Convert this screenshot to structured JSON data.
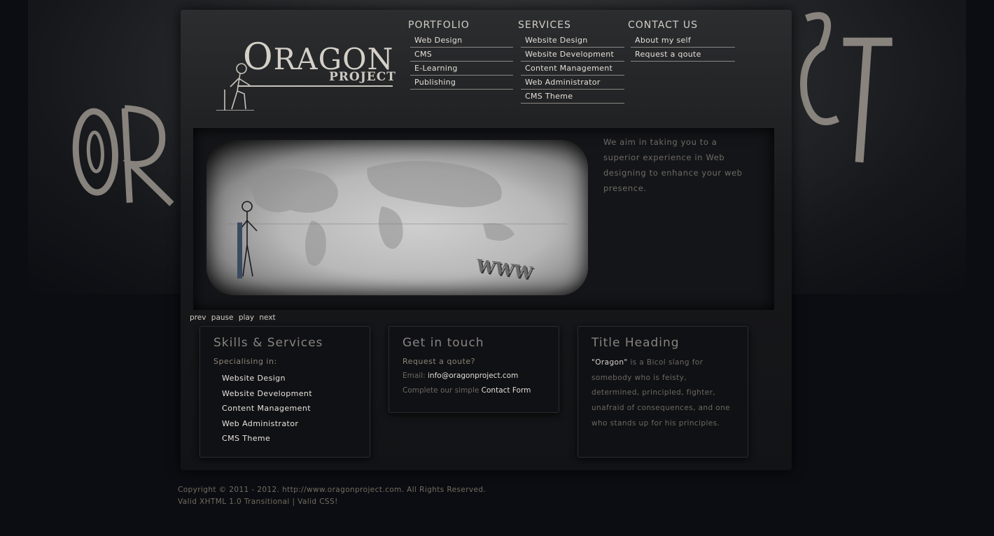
{
  "nav": {
    "portfolio": {
      "heading": "PORTFOLIO",
      "items": [
        "Web Design",
        "CMS",
        "E-Learning",
        "Publishing"
      ]
    },
    "services": {
      "heading": "SERVICES",
      "items": [
        "Website Design",
        "Website Development",
        "Content Management",
        "Web Administrator",
        "CMS Theme"
      ]
    },
    "contact": {
      "heading": "CONTACT US",
      "items": [
        "About my self",
        "Request a qoute"
      ]
    }
  },
  "logo": {
    "first": "O",
    "rest": "RAGON",
    "sub": "PROJECT"
  },
  "hero": {
    "tagline": "We aim in taking you to a superior experience in Web designing to enhance your web presence.",
    "sign_text": "WWW"
  },
  "slide_controls": {
    "prev": "prev",
    "pause": "pause",
    "play": "play",
    "next": "next"
  },
  "boxes": {
    "skills": {
      "title": "Skills & Services",
      "subtitle": "Specialising in:",
      "items": [
        "Website Design",
        "Website Development",
        "Content Management",
        "Web Administrator",
        "CMS Theme"
      ]
    },
    "contact": {
      "title": "Get in touch",
      "subtitle": "Request a qoute?",
      "email_label": "Email: ",
      "email": "info@oragonproject.com",
      "form_text": "Complete our simple ",
      "form_link": "Contact Form"
    },
    "about": {
      "title": "Title Heading",
      "quote": "\"Oragon\"",
      "text": " is a Bicol slang for somebody who is feisty, determined, principled, fighter, unafraid of consequences, and one who stands up for his principles."
    }
  },
  "footer": {
    "copyright": "Copyright © 2011 - 2012. http://www.oragonproject.com. All Rights Reserved.",
    "validity": "Valid XHTML 1.0 Transitional | Valid CSS!"
  },
  "colors": {
    "background": "#0b0d12",
    "panel": "#101114",
    "text_light": "#e4e0d8",
    "text_muted": "#6c6862",
    "footer_text": "#746c5f"
  }
}
